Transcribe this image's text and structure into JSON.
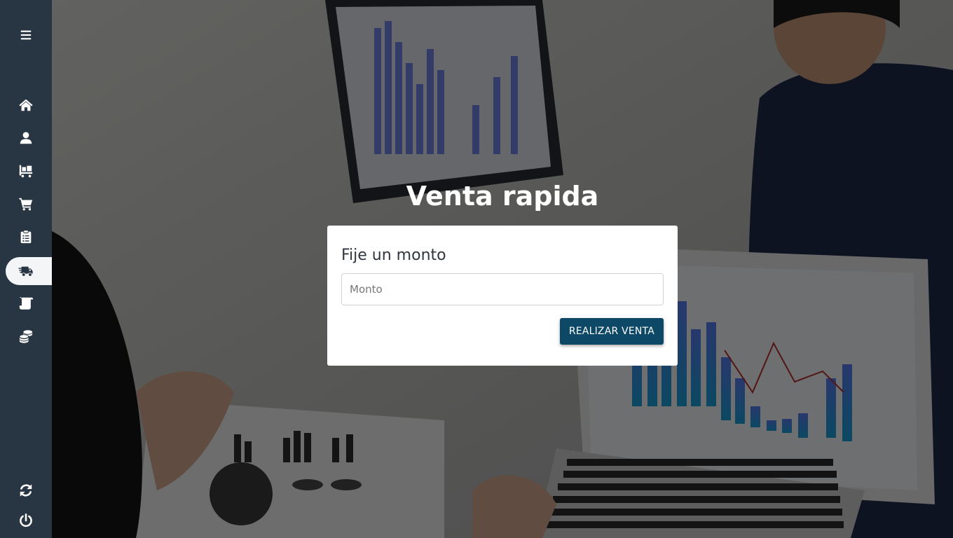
{
  "sidebar": {
    "items": [
      {
        "icon": "menu-icon"
      },
      {
        "icon": "home-icon"
      },
      {
        "icon": "user-icon"
      },
      {
        "icon": "pallet-icon"
      },
      {
        "icon": "cart-icon"
      },
      {
        "icon": "clipboard-icon"
      },
      {
        "icon": "truck-icon",
        "active": true
      },
      {
        "icon": "scroll-icon"
      },
      {
        "icon": "coins-icon"
      },
      {
        "icon": "sync-icon"
      },
      {
        "icon": "power-icon"
      }
    ],
    "colors": {
      "background": "#283542",
      "icon": "#ffffff",
      "active_background": "#f3f5f7",
      "active_icon": "#283542"
    }
  },
  "main": {
    "title": "Venta rapida",
    "card": {
      "label": "Fije un monto",
      "input_placeholder": "Monto",
      "input_value": "",
      "submit_label": "REALIZAR VENTA"
    }
  },
  "colors": {
    "accent": "#0d4966",
    "title_text": "#ffffff"
  }
}
